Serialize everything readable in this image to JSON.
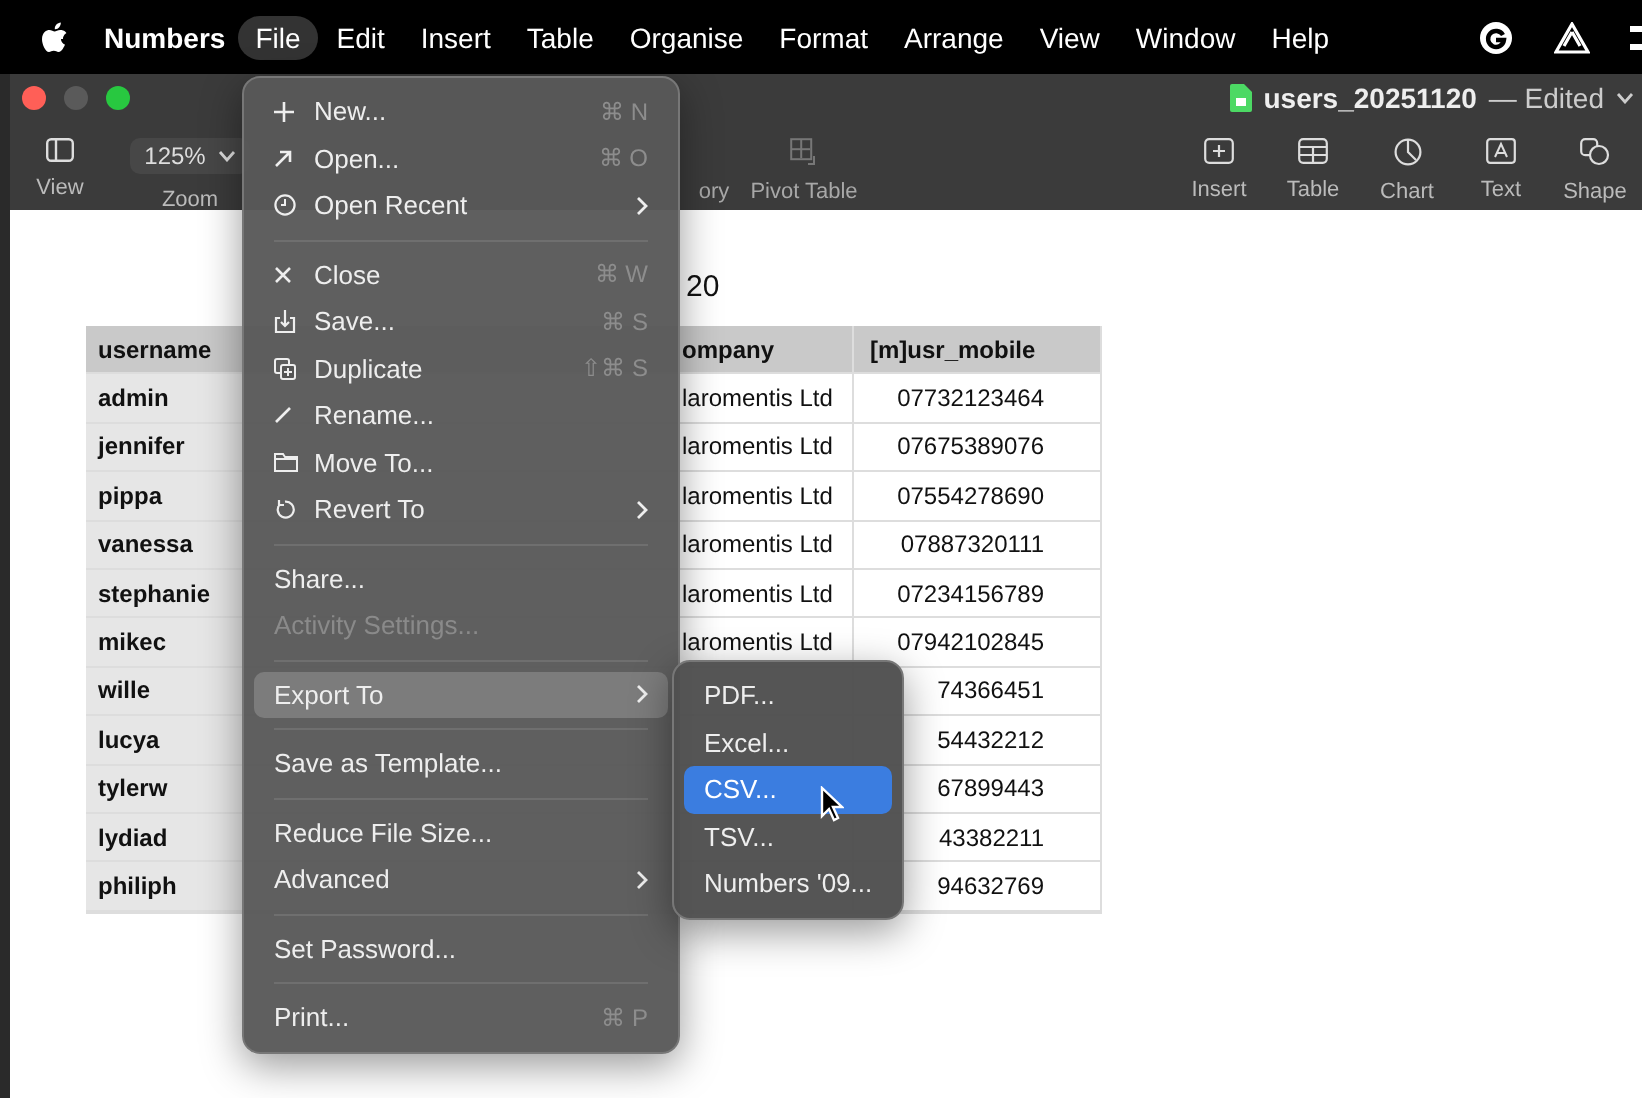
{
  "menu_bar": {
    "app": "Numbers",
    "items": [
      {
        "label": "File",
        "selected": true
      },
      {
        "label": "Edit",
        "selected": false
      },
      {
        "label": "Insert",
        "selected": false
      },
      {
        "label": "Table",
        "selected": false
      },
      {
        "label": "Organise",
        "selected": false
      },
      {
        "label": "Format",
        "selected": false
      },
      {
        "label": "Arrange",
        "selected": false
      },
      {
        "label": "View",
        "selected": false
      },
      {
        "label": "Window",
        "selected": false
      },
      {
        "label": "Help",
        "selected": false
      }
    ]
  },
  "window": {
    "title": "users_20251120",
    "status": "— Edited"
  },
  "toolbar": {
    "left": [
      {
        "label": "View"
      },
      {
        "label": "Zoom",
        "value": "125%"
      }
    ],
    "middle": [
      {
        "label": "ory",
        "disabled": true
      },
      {
        "label": "Pivot Table",
        "disabled": true
      }
    ],
    "right": [
      {
        "label": "Insert"
      },
      {
        "label": "Table"
      },
      {
        "label": "Chart"
      },
      {
        "label": "Text"
      },
      {
        "label": "Shape"
      }
    ]
  },
  "sheet": {
    "title": "20",
    "columns": [
      "username",
      "ompany",
      "[m]usr_mobile"
    ],
    "rows": [
      [
        "admin",
        "laromentis Ltd",
        "07732123464"
      ],
      [
        "jennifer",
        "laromentis Ltd",
        "07675389076"
      ],
      [
        "pippa",
        "laromentis Ltd",
        "07554278690"
      ],
      [
        "vanessa",
        "laromentis Ltd",
        "07887320111"
      ],
      [
        "stephanie",
        "laromentis Ltd",
        "07234156789"
      ],
      [
        "mikec",
        "laromentis Ltd",
        "07942102845"
      ],
      [
        "wille",
        "",
        "74366451"
      ],
      [
        "lucya",
        "",
        "54432212"
      ],
      [
        "tylerw",
        "",
        "67899443"
      ],
      [
        "lydiad",
        "",
        "43382211"
      ],
      [
        "philiph",
        "",
        "94632769"
      ]
    ]
  },
  "file_menu": [
    {
      "kind": "item",
      "label": "New...",
      "shortcut": "⌘ N",
      "submenu": false,
      "disabled": false,
      "selected": false
    },
    {
      "kind": "item",
      "label": "Open...",
      "shortcut": "⌘ O",
      "submenu": false,
      "disabled": false,
      "selected": false
    },
    {
      "kind": "item",
      "label": "Open Recent",
      "submenu": true,
      "disabled": false,
      "selected": false
    },
    {
      "kind": "separator"
    },
    {
      "kind": "item",
      "label": "Close",
      "shortcut": "⌘ W",
      "submenu": false,
      "disabled": false,
      "selected": false
    },
    {
      "kind": "item",
      "label": "Save...",
      "shortcut": "⌘ S",
      "submenu": false,
      "disabled": false,
      "selected": false
    },
    {
      "kind": "item",
      "label": "Duplicate",
      "shortcut": "⇧⌘ S",
      "submenu": false,
      "disabled": false,
      "selected": false
    },
    {
      "kind": "item",
      "label": "Rename...",
      "submenu": false,
      "disabled": false,
      "selected": false
    },
    {
      "kind": "item",
      "label": "Move To...",
      "submenu": false,
      "disabled": false,
      "selected": false
    },
    {
      "kind": "item",
      "label": "Revert To",
      "submenu": true,
      "disabled": false,
      "selected": false
    },
    {
      "kind": "separator"
    },
    {
      "kind": "item",
      "label": "Share...",
      "submenu": false,
      "disabled": false,
      "selected": false
    },
    {
      "kind": "item",
      "label": "Activity Settings...",
      "submenu": false,
      "disabled": true,
      "selected": false
    },
    {
      "kind": "separator"
    },
    {
      "kind": "item",
      "label": "Export To",
      "submenu": true,
      "disabled": false,
      "selected": true
    },
    {
      "kind": "separator"
    },
    {
      "kind": "item",
      "label": "Save as Template...",
      "submenu": false,
      "disabled": false,
      "selected": false
    },
    {
      "kind": "separator"
    },
    {
      "kind": "item",
      "label": "Reduce File Size...",
      "submenu": false,
      "disabled": false,
      "selected": false
    },
    {
      "kind": "item",
      "label": "Advanced",
      "submenu": true,
      "disabled": false,
      "selected": false
    },
    {
      "kind": "separator"
    },
    {
      "kind": "item",
      "label": "Set Password...",
      "submenu": false,
      "disabled": false,
      "selected": false
    },
    {
      "kind": "separator"
    },
    {
      "kind": "item",
      "label": "Print...",
      "shortcut": "⌘ P",
      "submenu": false,
      "disabled": false,
      "selected": false
    }
  ],
  "export_submenu": [
    {
      "label": "PDF...",
      "selected": false
    },
    {
      "label": "Excel...",
      "selected": false
    },
    {
      "label": "CSV...",
      "selected": true
    },
    {
      "label": "TSV...",
      "selected": false
    },
    {
      "label": "Numbers '09...",
      "selected": false
    }
  ]
}
